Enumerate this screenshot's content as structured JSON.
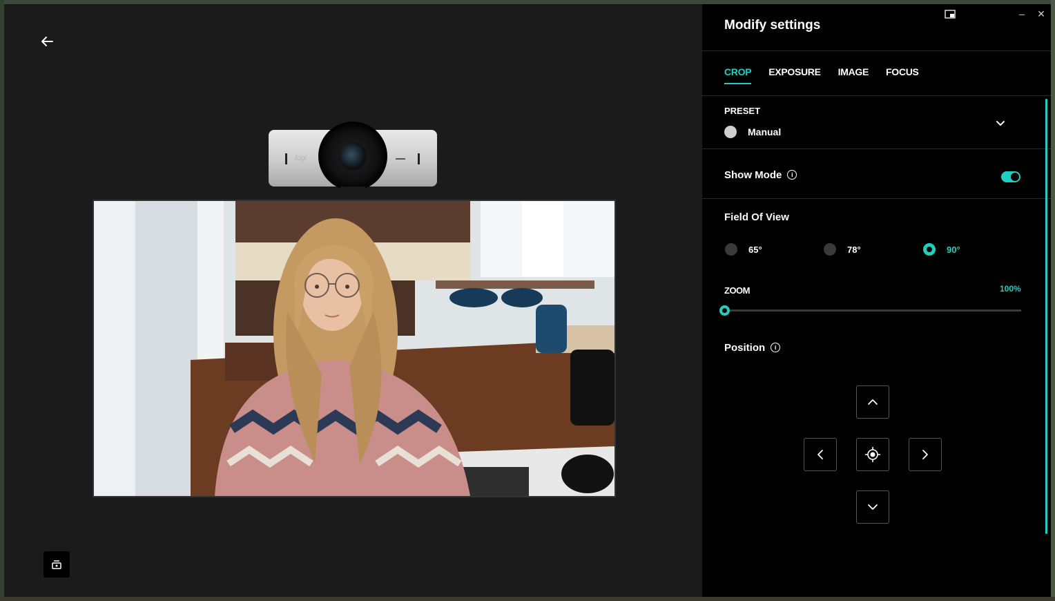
{
  "settings": {
    "title": "Modify settings",
    "tabs": [
      "CROP",
      "EXPOSURE",
      "IMAGE",
      "FOCUS"
    ],
    "active_tab": "CROP",
    "preset": {
      "label": "PRESET",
      "value": "Manual"
    },
    "show_mode": {
      "label": "Show Mode",
      "enabled": true
    },
    "field_of_view": {
      "label": "Field Of View",
      "options": [
        "65°",
        "78°",
        "90°"
      ],
      "selected": "90°"
    },
    "zoom": {
      "label": "ZOOM",
      "value_text": "100%",
      "level_fraction": 0.0
    },
    "position": {
      "label": "Position"
    },
    "window_controls": {
      "minimize": "–",
      "close": "✕"
    }
  },
  "camera": {
    "logo": "logi"
  },
  "colors": {
    "accent": "#1fd0c0",
    "panel": "#000000",
    "preview_bg": "#1b1b1b"
  },
  "icons": {
    "back": "arrow-left-icon",
    "tray": "webcam-tray-icon",
    "pip": "picture-in-picture-icon",
    "preset_expand": "chevron-down-icon",
    "info": "info-icon",
    "pad": [
      "chevron-up-icon",
      "chevron-left-icon",
      "recenter-icon",
      "chevron-right-icon",
      "chevron-down-icon"
    ]
  }
}
